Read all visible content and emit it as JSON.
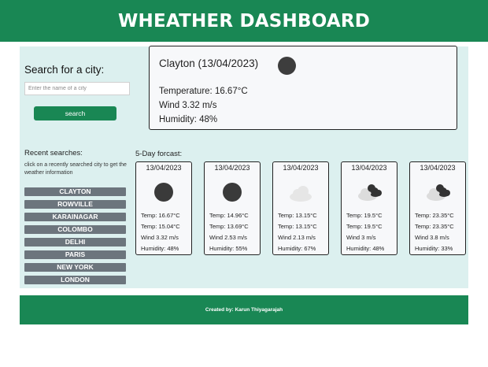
{
  "header": {
    "title": "WHEATHER DASHBOARD"
  },
  "search": {
    "title": "Search for a city:",
    "placeholder": "Enter the name of a city",
    "button_label": "search"
  },
  "current": {
    "title": "Clayton (13/04/2023)",
    "icon": "dark-circle-icon",
    "temperature": "Temperature: 16.67°C",
    "wind": "Wind 3.32 m/s",
    "humidity": "Humidity: 48%"
  },
  "recent": {
    "title": "Recent searches:",
    "hint": "click on a recently searched city to get the weather information",
    "cities": [
      "CLAYTON",
      "ROWVILLE",
      "KARAINAGAR",
      "COLOMBO",
      "DELHI",
      "PARIS",
      "NEW YORK",
      "LONDON"
    ]
  },
  "forecast": {
    "title": "5-Day forcast:",
    "days": [
      {
        "date": "13/04/2023",
        "icon": "dark-circle-icon",
        "temp": "Temp: 16.67°C",
        "temp2": "Temp: 15.04°C",
        "wind": "Wind 3.32 m/s",
        "humidity": "Humidity: 48%"
      },
      {
        "date": "13/04/2023",
        "icon": "dark-circle-icon",
        "temp": "Temp: 14.96°C",
        "temp2": "Temp: 13.69°C",
        "wind": "Wind 2.53 m/s",
        "humidity": "Humidity: 55%"
      },
      {
        "date": "13/04/2023",
        "icon": "light-cloud-icon",
        "temp": "Temp: 13.15°C",
        "temp2": "Temp: 13.15°C",
        "wind": "Wind 2.13 m/s",
        "humidity": "Humidity: 67%"
      },
      {
        "date": "13/04/2023",
        "icon": "broken-clouds-icon",
        "temp": "Temp: 19.5°C",
        "temp2": "Temp: 19.5°C",
        "wind": "Wind 3 m/s",
        "humidity": "Humidity: 48%"
      },
      {
        "date": "13/04/2023",
        "icon": "broken-clouds-icon",
        "temp": "Temp: 23.35°C",
        "temp2": "Temp: 23.35°C",
        "wind": "Wind 3.8 m/s",
        "humidity": "Humidity: 33%"
      }
    ]
  },
  "footer": {
    "credit": "Created by: Karun Thiyagarajah"
  },
  "colors": {
    "brand_green": "#198754",
    "panel_bg": "#dcf0ef",
    "city_button": "#6c757d"
  }
}
